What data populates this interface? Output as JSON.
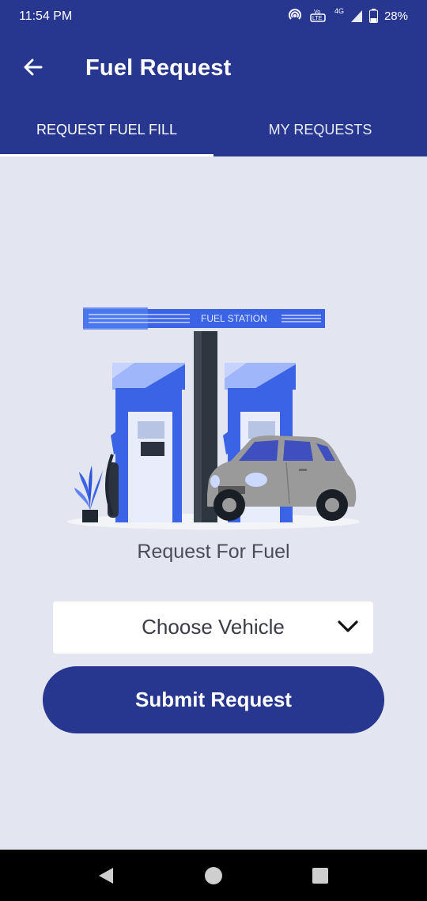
{
  "status_bar": {
    "time": "11:54 PM",
    "battery": "28%",
    "network": "4G",
    "icons": [
      "hotspot-icon",
      "volte-icon",
      "signal-icon",
      "battery-icon"
    ]
  },
  "app_bar": {
    "title": "Fuel Request",
    "back_icon": "arrow-left-icon"
  },
  "tabs": [
    {
      "label": "REQUEST FUEL FILL",
      "active": true
    },
    {
      "label": "MY REQUESTS",
      "active": false
    }
  ],
  "illustration": {
    "sign_text": "FUEL STATION"
  },
  "main": {
    "caption": "Request For Fuel",
    "vehicle_select": {
      "selected": "Choose Vehicle",
      "icon": "chevron-down-icon"
    },
    "submit_label": "Submit Request"
  },
  "nav_bar": {
    "buttons": [
      "back-triangle-icon",
      "home-circle-icon",
      "recents-square-icon"
    ]
  },
  "colors": {
    "primary": "#27378f",
    "background": "#e3e5f0",
    "illustration_blue": "#3a63e6",
    "car_gray": "#9a9a9a"
  }
}
